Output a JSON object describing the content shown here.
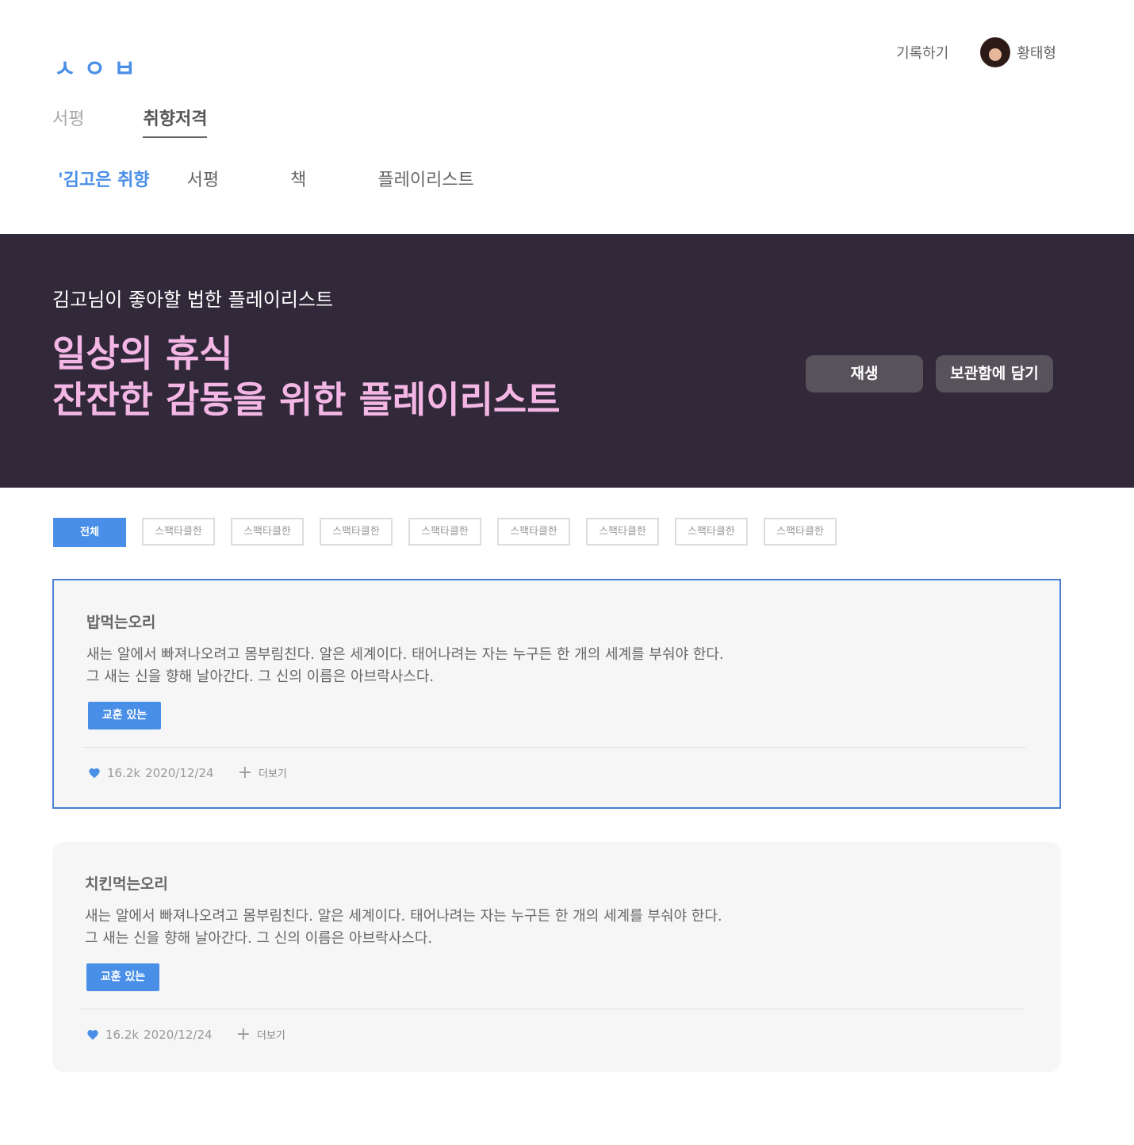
{
  "header": {
    "logo": "ㅅㅇㅂ",
    "record_link": "기록하기",
    "user_name": "황태형"
  },
  "main_tabs": [
    "서평",
    "취향저격"
  ],
  "sub_tabs": [
    "'김고은 취향",
    "서평",
    "책",
    "플레이리스트"
  ],
  "banner": {
    "subtitle": "김고님이 좋아할 법한 플레이리스트",
    "title_line1": "일상의 휴식",
    "title_line2": "잔잔한 감동을 위한 플레이리스트",
    "play_button": "재생",
    "save_button": "보관함에 담기"
  },
  "filters": [
    "전체",
    "스팩타클한",
    "스팩타클한",
    "스팩타클한",
    "스팩타클한",
    "스팩타클한",
    "스팩타클한",
    "스팩타클한",
    "스팩타클한"
  ],
  "cards": [
    {
      "author": "밥먹는오리",
      "text_line1": "새는 알에서 빠져나오려고 몸부림친다. 알은 세계이다. 태어나려는 자는 누구든 한 개의 세계를 부숴야 한다.",
      "text_line2": "그 새는 신을 향해 날아간다. 그 신의 이름은 아브락사스다.",
      "tag": "교훈 있는",
      "likes": "16.2k",
      "date": "2020/12/24",
      "more": "더보기"
    },
    {
      "author": "치킨먹는오리",
      "text_line1": "새는 알에서 빠져나오려고 몸부림친다. 알은 세계이다. 태어나려는 자는 누구든 한 개의 세계를 부숴야 한다.",
      "text_line2": "그 새는 신을 향해 날아간다. 그 신의 이름은 아브락사스다.",
      "tag": "교훈 있는",
      "likes": "16.2k",
      "date": "2020/12/24",
      "more": "더보기"
    }
  ],
  "colors": {
    "accent": "#4a8fe7",
    "banner_bg": "#31293a",
    "banner_title": "#f3b6e5"
  }
}
